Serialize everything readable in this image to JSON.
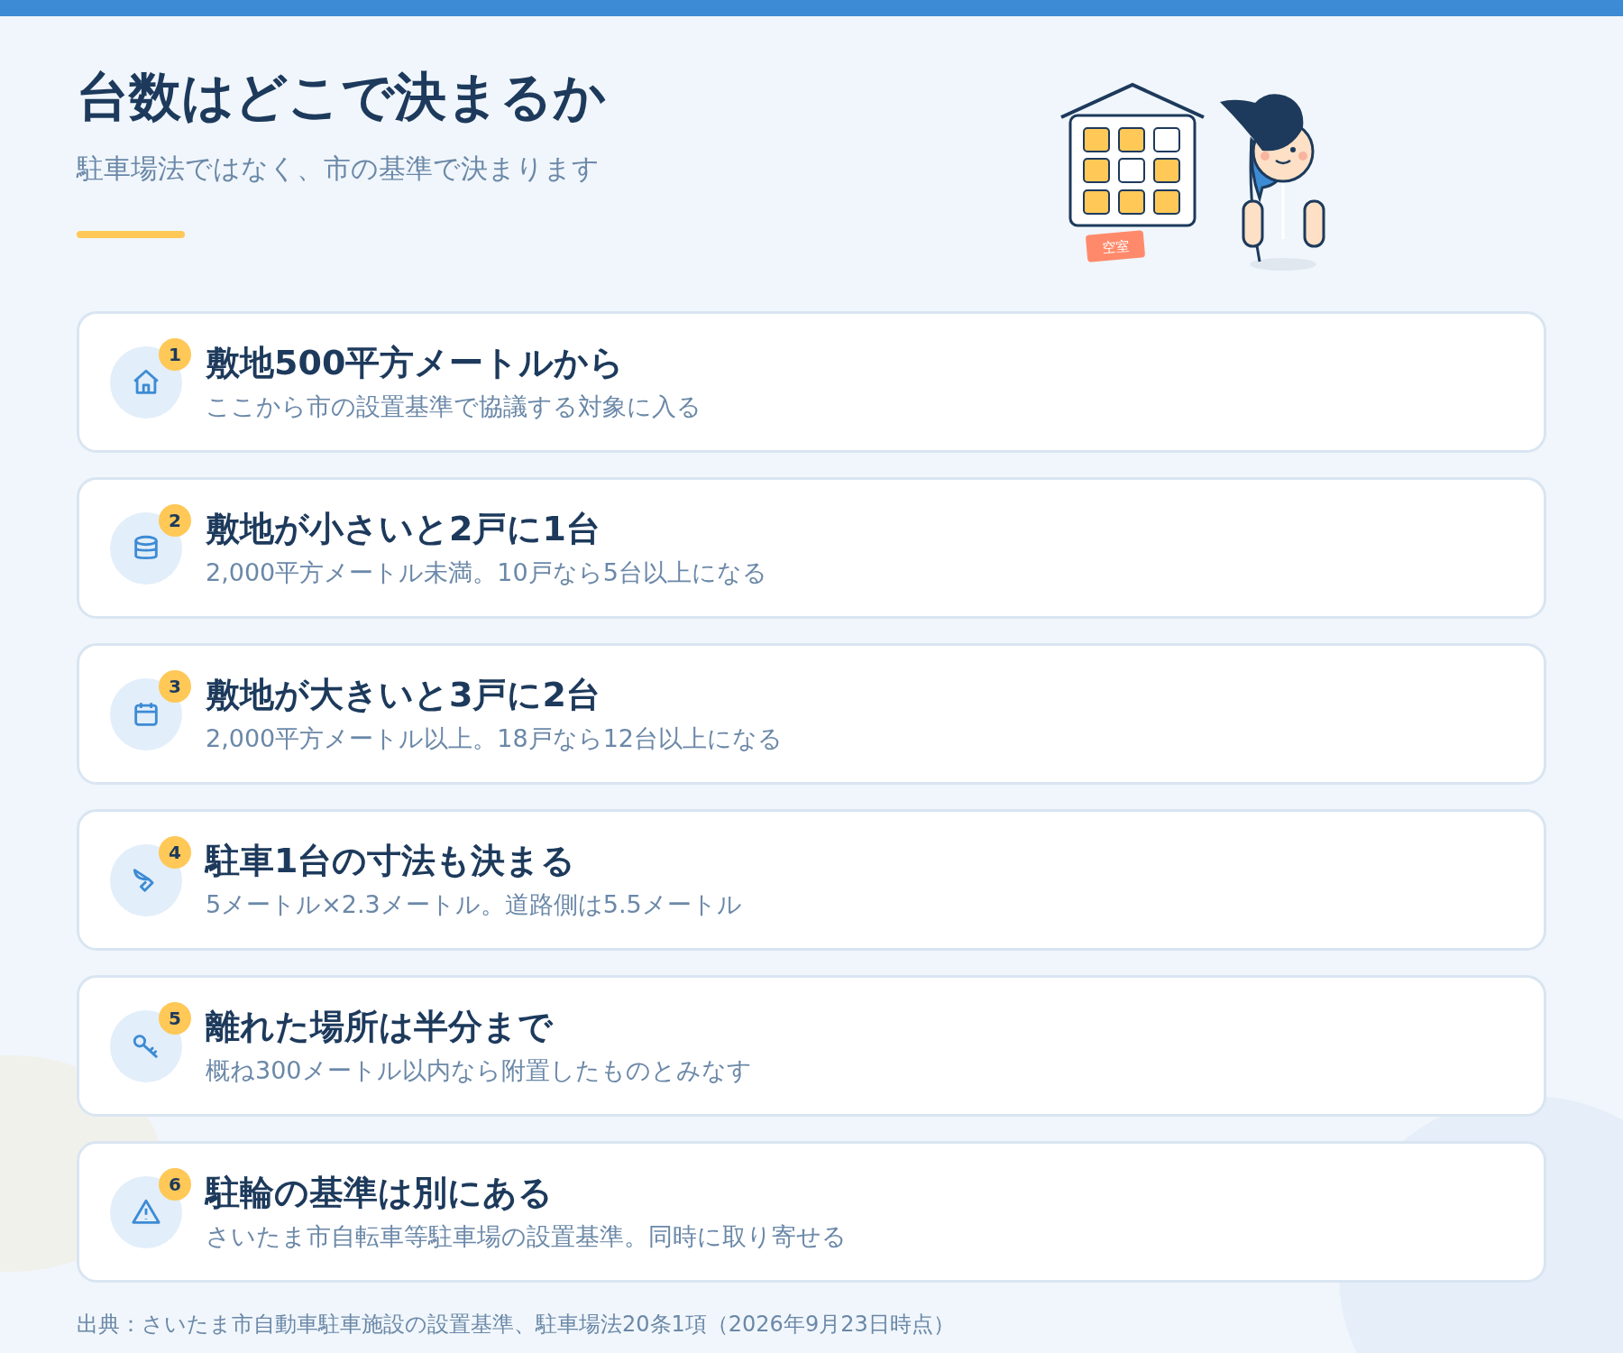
{
  "header": {
    "title": "台数はどこで決まるか",
    "subtitle": "駐車場法ではなく、市の基準で決まります"
  },
  "illustration": {
    "tag": "空室",
    "windows": [
      {
        "lit": true
      },
      {
        "lit": true
      },
      {
        "lit": false
      },
      {
        "lit": true
      },
      {
        "lit": false
      },
      {
        "lit": true
      },
      {
        "lit": true
      },
      {
        "lit": true
      },
      {
        "lit": true
      }
    ]
  },
  "items": [
    {
      "number": "1",
      "kind": "house",
      "title": "敷地500平方メートルから",
      "description": "ここから市の設置基準で協議する対象に入る"
    },
    {
      "number": "2",
      "kind": "database",
      "title": "敷地が小さいと2戸に1台",
      "description": "2,000平方メートル未満。10戸なら5台以上になる"
    },
    {
      "number": "3",
      "kind": "calendar",
      "title": "敷地が大きいと3戸に2台",
      "description": "2,000平方メートル以上。18戸なら12台以上になる"
    },
    {
      "number": "4",
      "kind": "brush",
      "title": "駐車1台の寸法も決まる",
      "description": "5メートル×2.3メートル。道路側は5.5メートル"
    },
    {
      "number": "5",
      "kind": "key",
      "title": "離れた場所は半分まで",
      "description": "概ね300メートル以内なら附置したものとみなす"
    },
    {
      "number": "6",
      "kind": "warning",
      "title": "駐輪の基準は別にある",
      "description": "さいたま市自転車等駐車場の設置基準。同時に取り寄せる"
    }
  ],
  "footer": {
    "source": "出典：さいたま市自動車駐車施設の設置基準、駐車場法20条1項（2026年9月23日時点）"
  }
}
